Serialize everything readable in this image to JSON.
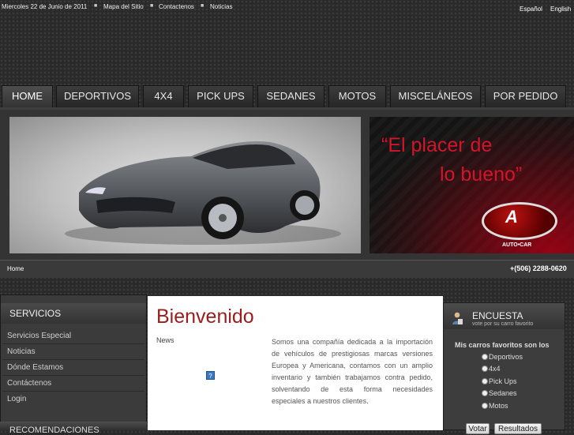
{
  "topbar": {
    "date": "Miercoles 22 de Junio de 2011",
    "links": [
      "Mapa del Sitio",
      "Contactenos",
      "Noticias"
    ],
    "languages": [
      "Español",
      "English"
    ]
  },
  "nav": {
    "tabs": [
      "HOME",
      "DEPORTIVOS",
      "4X4",
      "PICK UPS",
      "SEDANES",
      "MOTOS",
      "MISCELÁNEOS",
      "POR PEDIDO"
    ],
    "active": "HOME"
  },
  "banner": {
    "slogan_line1": "“El placer de",
    "slogan_line2": "lo bueno”",
    "logo_text": "AUTO•CAR"
  },
  "breadcrumb": {
    "current": "Home",
    "phone": "+(506) 2288-0620"
  },
  "sidebar": {
    "title": "SERVICIOS",
    "items": [
      "Servicios Especial",
      "Noticias",
      "Dónde Estamos",
      "Contáctenos",
      "Login"
    ],
    "next_section": "RECOMENDACIONES"
  },
  "main": {
    "heading": "Bienvenido",
    "news_label": "News",
    "about": "Somos una compañía dedicada a la importación de vehículos de prestigiosas marcas versiones Europea y Americana, contamos con un amplio inventario y también trabajamos contra pedido, solventando de esta forma necesidades especiales a nuestros clientes."
  },
  "poll": {
    "title": "ENCUESTA",
    "subtitle": "vote por su carro favorito",
    "question": "Mis carros favoritos son los",
    "options": [
      "Deportivos",
      "4x4",
      "Pick Ups",
      "Sedanes",
      "Motos"
    ],
    "vote_label": "Votar",
    "results_label": "Resultados"
  },
  "colors": {
    "accent_red": "#9b1c1c",
    "slogan_red": "#d4142a",
    "background": "#2a2a2a"
  }
}
